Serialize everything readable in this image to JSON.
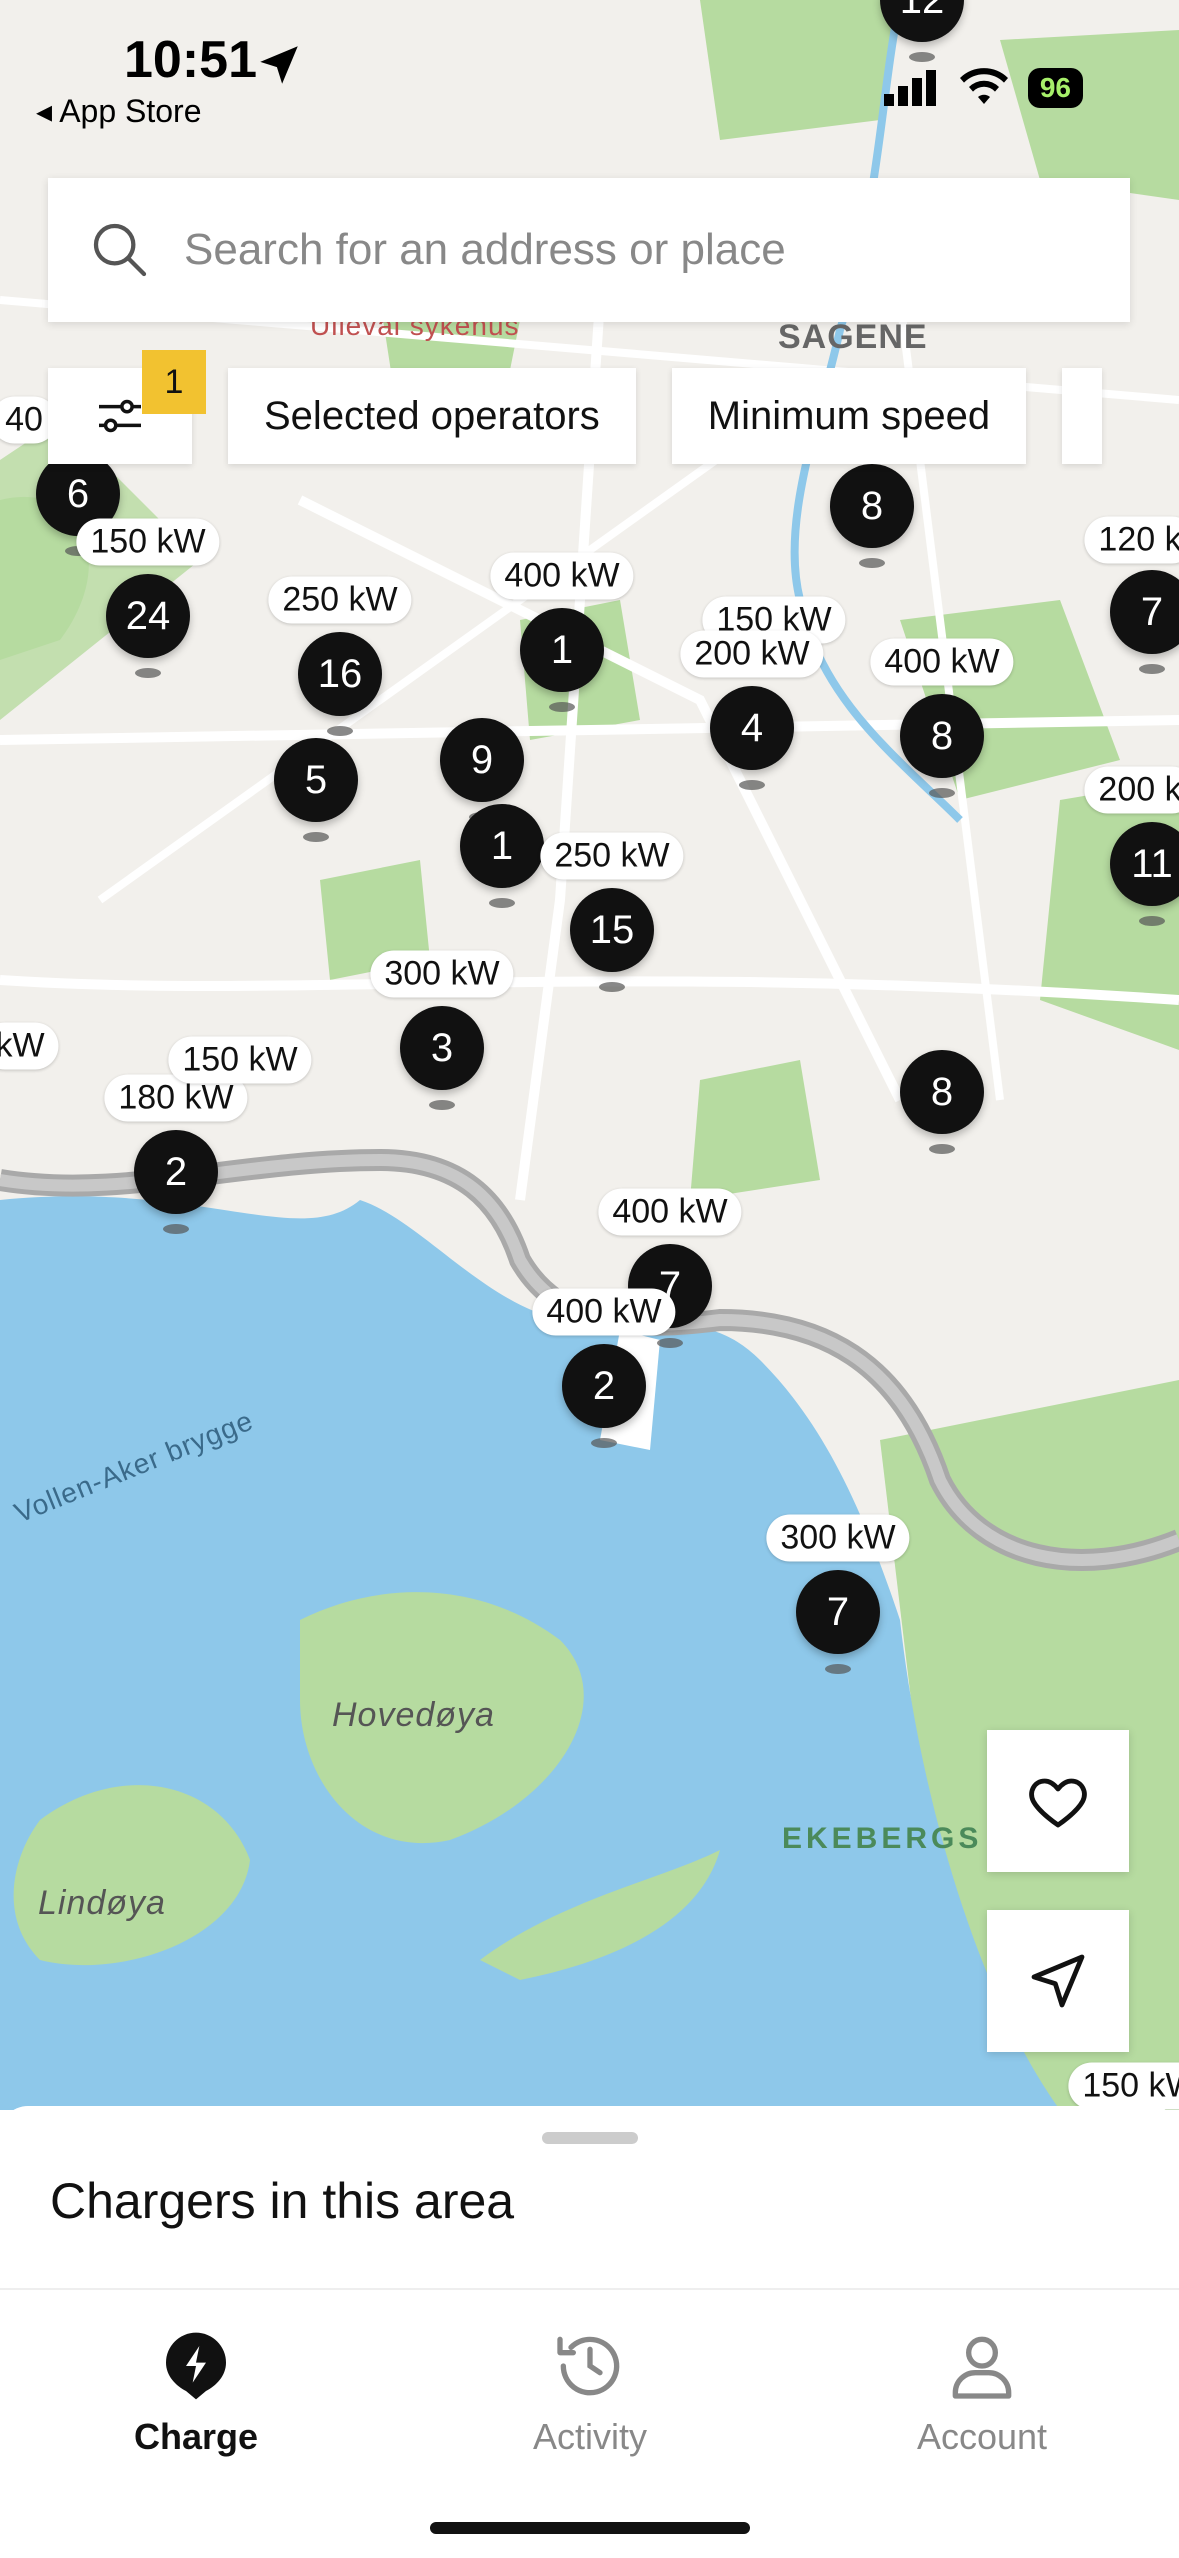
{
  "status": {
    "time": "10:51",
    "back_label": "◂ App Store",
    "battery": "96"
  },
  "search": {
    "placeholder": "Search for an address or place"
  },
  "filters": {
    "badge_count": "1",
    "chips": [
      "Selected operators",
      "Minimum speed"
    ]
  },
  "map_labels": {
    "sagene": "SAGENE",
    "ulleval": "Ullevål sykehus",
    "vollen": "Vollen-Aker brygge",
    "hovedoya": "Hovedøya",
    "lindoya": "Lindøya",
    "ekeberg": "EKEBERGS"
  },
  "pins": [
    {
      "count": "12"
    },
    {
      "count": "6"
    },
    {
      "count": "24"
    },
    {
      "count": "16"
    },
    {
      "count": "5"
    },
    {
      "count": "9"
    },
    {
      "count": "1"
    },
    {
      "count": "1"
    },
    {
      "count": "15"
    },
    {
      "count": "4"
    },
    {
      "count": "8"
    },
    {
      "count": "8"
    },
    {
      "count": "7"
    },
    {
      "count": "11"
    },
    {
      "count": "3"
    },
    {
      "count": "8"
    },
    {
      "count": "2"
    },
    {
      "count": "7"
    },
    {
      "count": "2"
    },
    {
      "count": "7"
    }
  ],
  "power_labels": [
    "150 kW",
    "250 kW",
    "400 kW",
    "150 kW",
    "200 kW",
    "400 kW",
    "120 k",
    "200 k",
    "250 kW",
    "300 kW",
    "180 kW",
    "400 kW",
    "400 kW",
    "300 kW",
    "150 kW",
    "40",
    "kW",
    "150 kW"
  ],
  "sheet": {
    "title": "Chargers in this area"
  },
  "tabs": [
    {
      "label": "Charge",
      "active": true
    },
    {
      "label": "Activity",
      "active": false
    },
    {
      "label": "Account",
      "active": false
    }
  ],
  "colors": {
    "accent": "#111111",
    "badge": "#f2c230",
    "water": "#8ec8ea",
    "park": "#b6dba0"
  }
}
